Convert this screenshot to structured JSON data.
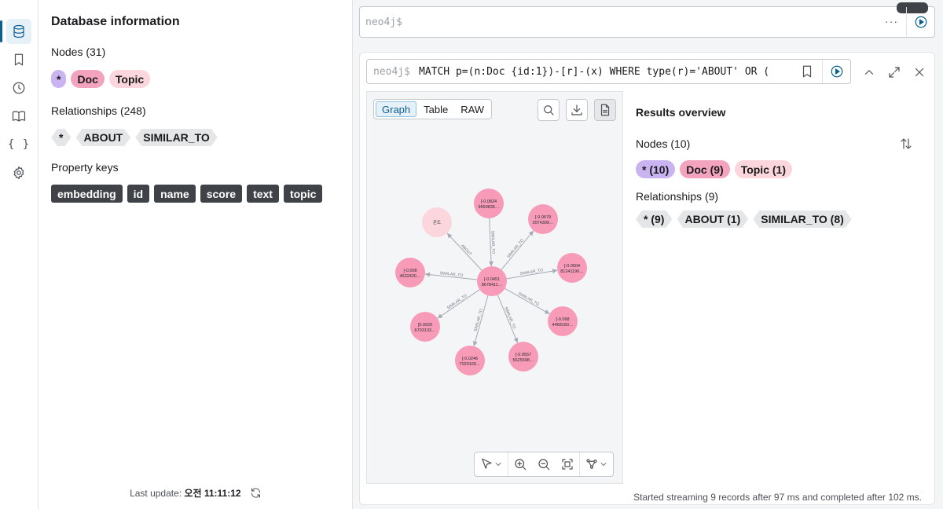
{
  "rail": {
    "items": [
      {
        "name": "database-icon"
      },
      {
        "name": "bookmark-icon"
      },
      {
        "name": "history-icon"
      },
      {
        "name": "book-icon"
      },
      {
        "name": "braces-icon",
        "glyph": "{ }"
      },
      {
        "name": "gear-icon"
      }
    ]
  },
  "db": {
    "title": "Database information",
    "nodes_label": "Nodes (31)",
    "node_labels": [
      "*",
      "Doc",
      "Topic"
    ],
    "relationships_label": "Relationships (248)",
    "rel_types": [
      "*",
      "ABOUT",
      "SIMILAR_TO"
    ],
    "property_keys_label": "Property keys",
    "property_keys": [
      "embedding",
      "id",
      "name",
      "score",
      "text",
      "topic"
    ],
    "last_update_prefix": "Last update: ",
    "last_update_time": "오전 11:11:12"
  },
  "editor": {
    "prompt": "neo4j$",
    "more": "···"
  },
  "frame": {
    "prompt": "neo4j$",
    "query": "MATCH p=(n:Doc {id:1})-[r]-(x) WHERE type(r)='ABOUT' OR (",
    "view_tabs": [
      "Graph",
      "Table",
      "RAW"
    ],
    "active_tab": "Graph",
    "status": "Started streaming 9 records after 97 ms and completed after 102 ms."
  },
  "graph": {
    "center": {
      "line1": "[-0.0451",
      "line2": "8678411…"
    },
    "topic_node": {
      "label": "온도"
    },
    "nodes": [
      {
        "line1": "[-0.0824",
        "line2": "9659836…",
        "rel": "SIMILAR_TO"
      },
      {
        "line1": "[-0.0679",
        "line2": "3074309…",
        "rel": "SIMILAR_TO"
      },
      {
        "line1": "[-0.0504",
        "line2": "81241196…",
        "rel": "SIMILAR_TO"
      },
      {
        "line1": "[-0.068",
        "line2": "4468150…",
        "rel": "SIMILAR_TO"
      },
      {
        "line1": "[-0.0557",
        "line2": "5625598…",
        "rel": "SIMILAR_TO"
      },
      {
        "line1": "[-0.0246",
        "line2": "7029169…",
        "rel": "SIMILAR_TO"
      },
      {
        "line1": "[0.0020",
        "line2": "6703133…",
        "rel": "SIMILAR_TO"
      },
      {
        "line1": "[-0.008",
        "line2": "4632420…",
        "rel": "SIMILAR_TO"
      }
    ],
    "topic_rel": "ABOUT",
    "colors": {
      "doc": "#f79bb8",
      "topic": "#fbd6dc",
      "edge": "#a5abb6"
    }
  },
  "overview": {
    "title": "Results overview",
    "nodes_label": "Nodes (10)",
    "node_chips": [
      "* (10)",
      "Doc (9)",
      "Topic (1)"
    ],
    "relationships_label": "Relationships (9)",
    "rel_chips": [
      "* (9)",
      "ABOUT (1)",
      "SIMILAR_TO (8)"
    ]
  }
}
